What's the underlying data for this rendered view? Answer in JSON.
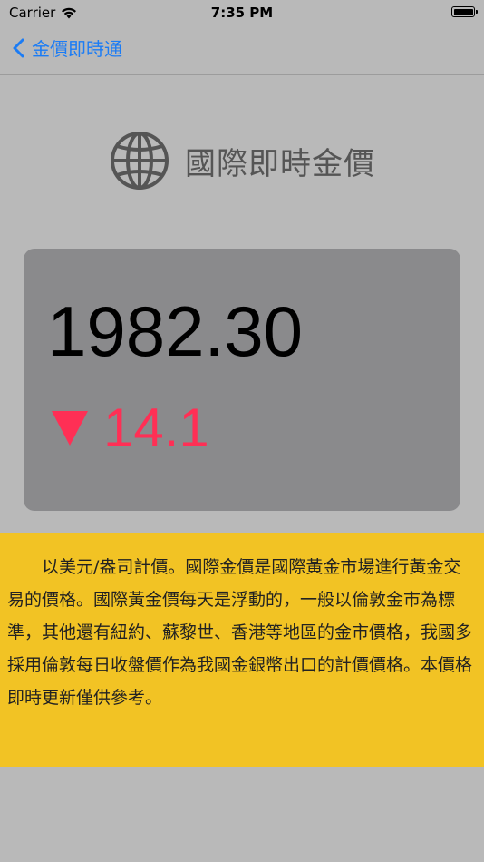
{
  "status_bar": {
    "carrier": "Carrier",
    "time": "7:35 PM"
  },
  "nav": {
    "back_label": "金價即時通"
  },
  "header": {
    "icon": "globe-icon",
    "title": "國際即時金價"
  },
  "price": {
    "value": "1982.30",
    "change": "14.1",
    "direction": "down",
    "change_color": "#ff2f55"
  },
  "description": {
    "text": "以美元/盎司計價。國際金價是國際黃金市場進行黃金交易的價格。國際黃金價每天是浮動的，一般以倫敦金市為標準，其他還有紐約、蘇黎世、香港等地區的金市價格，我國多採用倫敦每日收盤價作為我國金銀幣出口的計價價格。本價格即時更新僅供參考。"
  },
  "colors": {
    "accent": "#1b7cf5",
    "panel": "#f2c324",
    "card": "#8a8a8c"
  }
}
